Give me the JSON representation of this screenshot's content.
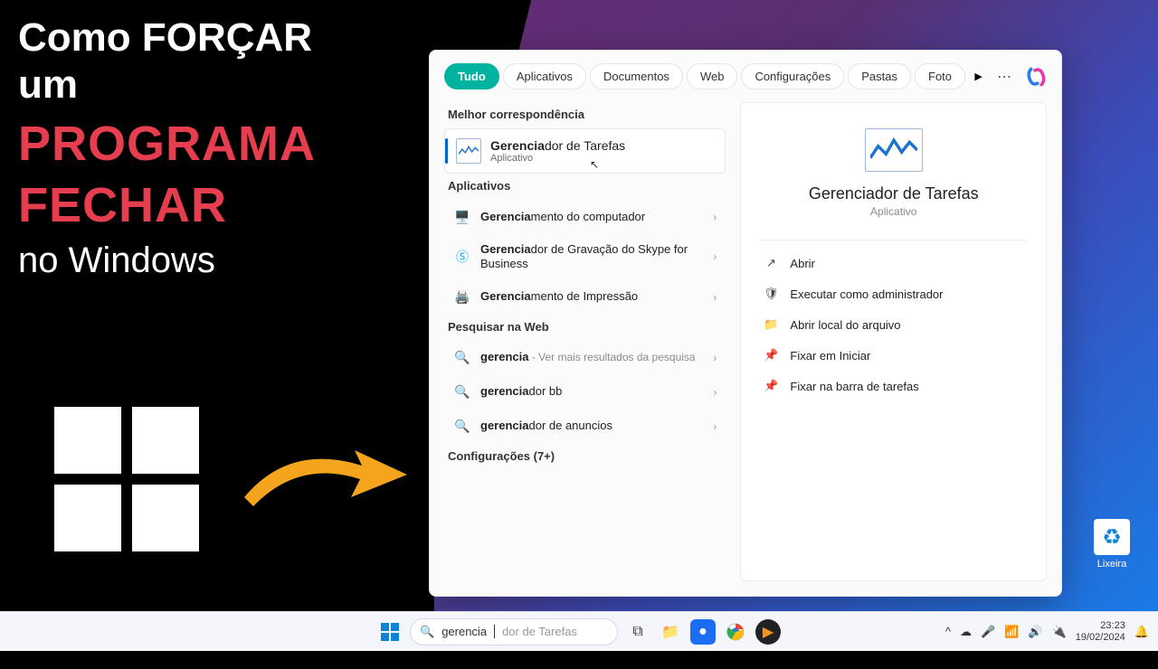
{
  "thumbnail": {
    "line1": "Como FORÇAR",
    "line2": "um",
    "line3": "PROGRAMA",
    "line4": "FECHAR",
    "line5": "no Windows"
  },
  "recycle_label": "Lixeira",
  "popup": {
    "tabs": [
      "Tudo",
      "Aplicativos",
      "Documentos",
      "Web",
      "Configurações",
      "Pastas",
      "Foto"
    ],
    "best_match_label": "Melhor correspondência",
    "best_match": {
      "prefix": "Gerencia",
      "rest": "dor de Tarefas",
      "subtitle": "Aplicativo"
    },
    "apps_label": "Aplicativos",
    "apps": [
      {
        "prefix": "Gerencia",
        "rest": "mento do computador"
      },
      {
        "prefix": "Gerencia",
        "rest": "dor de Gravação do Skype for Business"
      },
      {
        "prefix": "Gerencia",
        "rest": "mento de Impressão"
      }
    ],
    "web_label": "Pesquisar na Web",
    "web": [
      {
        "prefix": "gerencia",
        "rest": "",
        "sub": " - Ver mais resultados da pesquisa"
      },
      {
        "prefix": "gerencia",
        "rest": "dor bb",
        "sub": ""
      },
      {
        "prefix": "gerencia",
        "rest": "dor de anuncios",
        "sub": ""
      }
    ],
    "settings_label": "Configurações (7+)",
    "preview": {
      "title": "Gerenciador de Tarefas",
      "subtitle": "Aplicativo",
      "actions": [
        {
          "icon": "open",
          "label": "Abrir"
        },
        {
          "icon": "admin",
          "label": "Executar como administrador"
        },
        {
          "icon": "folder",
          "label": "Abrir local do arquivo"
        },
        {
          "icon": "pin",
          "label": "Fixar em Iniciar"
        },
        {
          "icon": "pin",
          "label": "Fixar na barra de tarefas"
        }
      ]
    }
  },
  "taskbar": {
    "search_typed": "gerencia",
    "search_placeholder_rest": "dor de Tarefas",
    "time": "23:23",
    "date": "19/02/2024"
  }
}
